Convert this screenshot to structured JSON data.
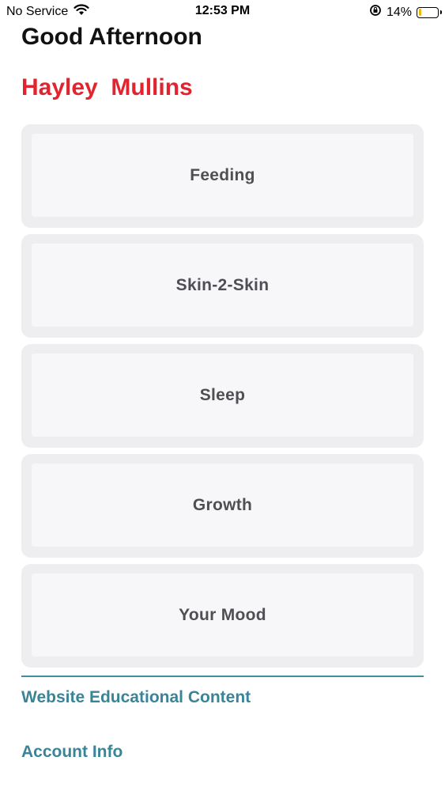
{
  "status_bar": {
    "carrier": "No Service",
    "time": "12:53 PM",
    "battery_percent": "14%",
    "battery_level": 0.14,
    "battery_color": "#f3b60f"
  },
  "header": {
    "greeting": "Good Afternoon",
    "user_name": "Hayley  Mullins"
  },
  "tiles": [
    {
      "label": "Feeding"
    },
    {
      "label": "Skin-2-Skin"
    },
    {
      "label": "Sleep"
    },
    {
      "label": "Growth"
    },
    {
      "label": "Your Mood"
    }
  ],
  "links": {
    "website_content": "Website Educational Content",
    "account_info": "Account Info"
  },
  "colors": {
    "accent_red": "#e2242f",
    "link_teal": "#3a8497",
    "tile_bg": "#eeedf0"
  }
}
